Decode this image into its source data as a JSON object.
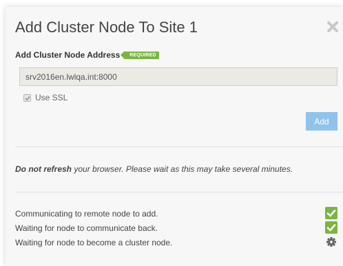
{
  "dialog": {
    "title": "Add Cluster Node To Site 1",
    "close_icon": "close-icon"
  },
  "form": {
    "field_label": "Add Cluster Node Address",
    "required_badge": "REQUIRED",
    "address_value": "srv2016en.lwlqa.int:8000",
    "use_ssl_label": "Use SSL",
    "use_ssl_checked": true,
    "add_label": "Add"
  },
  "notice": {
    "bold": "Do not refresh",
    "rest": " your browser. Please wait as this may take several minutes."
  },
  "steps": [
    {
      "text": "Communicating to remote node to add.",
      "status": "done",
      "icon": "check-icon"
    },
    {
      "text": "Waiting for node to communicate back.",
      "status": "done",
      "icon": "check-icon"
    },
    {
      "text": "Waiting for node to become a cluster node.",
      "status": "in-progress",
      "icon": "gear-icon"
    }
  ],
  "colors": {
    "dialog_bg": "#f7f7f7",
    "accent_green": "#7cb342",
    "add_button": "#90c3ec",
    "gear": "#666666"
  }
}
